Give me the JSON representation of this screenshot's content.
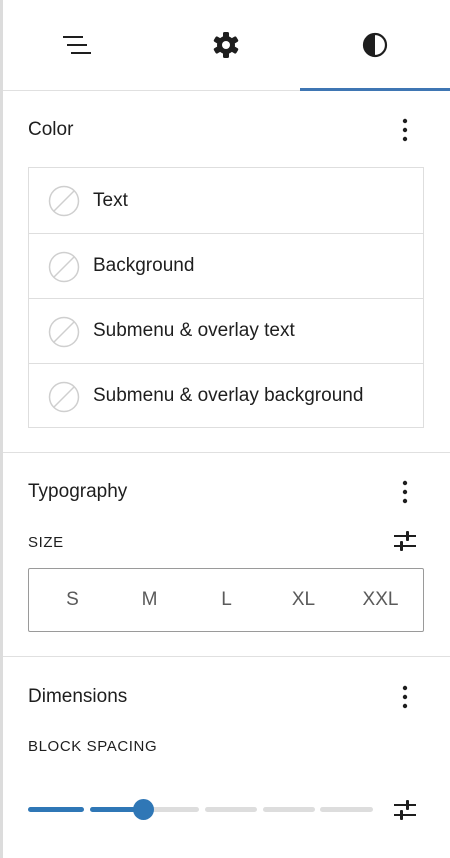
{
  "tabs": [
    {
      "name": "list-view",
      "icon": "list-view-icon"
    },
    {
      "name": "settings",
      "icon": "gear-icon"
    },
    {
      "name": "styles",
      "icon": "half-circle-contrast-icon",
      "active": true
    }
  ],
  "color": {
    "title": "Color",
    "items": [
      {
        "label": "Text"
      },
      {
        "label": "Background"
      },
      {
        "label": "Submenu & overlay text"
      },
      {
        "label": "Submenu & overlay background"
      }
    ]
  },
  "typography": {
    "title": "Typography",
    "size_label": "SIZE",
    "sizes": [
      "S",
      "M",
      "L",
      "XL",
      "XXL"
    ]
  },
  "dimensions": {
    "title": "Dimensions",
    "spacing_label": "BLOCK SPACING",
    "spacing_steps": 6,
    "spacing_value_step": 2
  },
  "colors": {
    "accent": "#2f77b6",
    "text": "#1e1e1e",
    "border": "#e0e0e0"
  }
}
